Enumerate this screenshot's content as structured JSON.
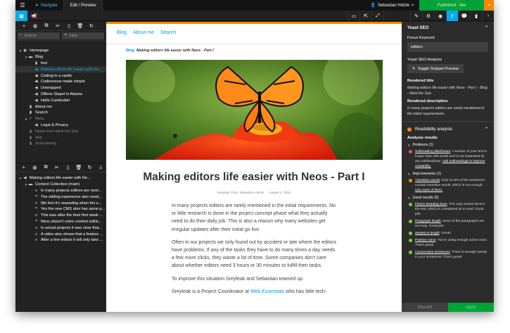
{
  "topbar": {
    "menu_icon": "hamburger-icon",
    "navigate_label": "Navigate",
    "edit_label": "Edit / Preview",
    "user_name": "Sebastian Helzle",
    "published_label": "Published - live",
    "published_color": "#00a338",
    "dropdown_color": "#ff8700"
  },
  "tree": {
    "search_placeholder": "Search",
    "filter_placeholder": "Filter",
    "nodes": [
      {
        "label": "Homepage",
        "depth": 0,
        "icon": "globe-icon",
        "toggle": "▼"
      },
      {
        "label": "Blog",
        "depth": 1,
        "icon": "folder-icon",
        "toggle": "▼"
      },
      {
        "label": "test",
        "depth": 2,
        "icon": "page-icon",
        "toggle": ""
      },
      {
        "label": "Making editors life easier with Ne...",
        "depth": 2,
        "icon": "megaphone-icon",
        "toggle": "",
        "selected": true
      },
      {
        "label": "Coding in a castle",
        "depth": 2,
        "icon": "megaphone-icon",
        "toggle": ""
      },
      {
        "label": "Codereview made simple",
        "depth": 2,
        "icon": "megaphone-icon",
        "toggle": ""
      },
      {
        "label": "Unwrapped",
        "depth": 2,
        "icon": "megaphone-icon",
        "toggle": ""
      },
      {
        "label": "Offene Stapel in Atlanta",
        "depth": 2,
        "icon": "megaphone-icon",
        "toggle": ""
      },
      {
        "label": "Hello Cambodia!",
        "depth": 2,
        "icon": "megaphone-icon",
        "toggle": ""
      },
      {
        "label": "About me",
        "depth": 1,
        "icon": "page-icon",
        "toggle": ""
      },
      {
        "label": "Search",
        "depth": 1,
        "icon": "page-icon",
        "toggle": ""
      },
      {
        "label": "Meta",
        "depth": 1,
        "icon": "share-icon",
        "toggle": "▼",
        "muted": true
      },
      {
        "label": "Legal & Privacy",
        "depth": 2,
        "icon": "megaphone-icon",
        "toggle": ""
      },
      {
        "label": "News from mind the Seb",
        "depth": 1,
        "icon": "page-icon",
        "toggle": "",
        "muted": true
      },
      {
        "label": "404",
        "depth": 1,
        "icon": "page-icon",
        "toggle": "",
        "muted": true
      },
      {
        "label": "Schaubourg",
        "depth": 1,
        "icon": "page-icon",
        "toggle": "",
        "muted": true
      }
    ]
  },
  "content_tree": {
    "nodes": [
      {
        "label": "Making editors life easier with Ne...",
        "depth": 0,
        "icon": "megaphone-icon",
        "toggle": "▼"
      },
      {
        "label": "Content Collection (main)",
        "depth": 1,
        "icon": "folder-icon",
        "toggle": "▼"
      },
      {
        "label": "In many projects editors are rarel...",
        "depth": 2,
        "icon": "text-icon",
        "toggle": ""
      },
      {
        "label": "The editing experience also need...",
        "depth": 2,
        "icon": "quote-icon",
        "toggle": ""
      },
      {
        "label": "We feel it's rewarding when the e...",
        "depth": 2,
        "icon": "text-icon",
        "toggle": ""
      },
      {
        "label": "Yes the new CMS also has some p...",
        "depth": 2,
        "icon": "quote-icon",
        "toggle": ""
      },
      {
        "label": "This was after the their first week ...",
        "depth": 2,
        "icon": "text-icon",
        "toggle": ""
      },
      {
        "label": "Neos doesn't solve content editin...",
        "depth": 2,
        "icon": "quote-icon",
        "toggle": ""
      },
      {
        "label": "In actual projects it was clear that...",
        "depth": 2,
        "icon": "text-icon",
        "toggle": ""
      },
      {
        "label": "A video also shows that a feature ...",
        "depth": 2,
        "icon": "text-icon",
        "toggle": ""
      },
      {
        "label": "After a few videos it will only take ...",
        "depth": 2,
        "icon": "text-icon",
        "toggle": ""
      }
    ]
  },
  "page": {
    "nav": [
      "Blog",
      "About me",
      "Search"
    ],
    "breadcrumb_link": "Blog",
    "breadcrumb_current": "Making editors life easier with Neos - Part I",
    "title": "Making editors life easier with Neos - Part I",
    "author": "Sreyleak Thue, Sebastian Helzle",
    "date": "August 3, 2015",
    "paragraph1": "In many projects editors are rarely mentioned in the initial requirements. No or little research is done in the project concept phase what they actually need to do their daily job. This is also a reason why many websites get irregular updates after their initial go live.",
    "paragraph2": "Often in our projects we only found out by accident or late where the editors have problems. If any of the tasks they have to do many times a day needs a few more clicks, they waste a lot of time. Some companies don't care about whether editors need 3 hours or 30 minutes to fulfill their tasks.",
    "paragraph3": "To improve this situation Sreyleak and Sebastian teamed up.",
    "paragraph4_a": "Sreyleak is a Project Coordinator at ",
    "paragraph4_link": "Web Essentials",
    "paragraph4_b": " who has little tech-"
  },
  "inspector": {
    "section_title": "Yoast SEO",
    "focus_keyword_label": "Focus Keyword",
    "focus_keyword_value": "editors",
    "analysis_label": "Yoast SEO Analysis",
    "toggle_button": "Toggle Snippet Preview",
    "rendered_title_label": "Rendered title",
    "rendered_title_value": "Making editors life easier with Neos - Part I - Blog - Mind the Seb",
    "rendered_desc_label": "Rendered description",
    "rendered_desc_value": "In many projects editors are rarely mentioned in the initial requirements.",
    "readability_label": "Readability analysis",
    "results_label": "Analysis results",
    "problems_label": "Problems (1)",
    "problem1_link": "Subheading distribution",
    "problem1_text": ": 1 section of your text is longer than 300 words and is not separated by any subheadings. ",
    "problem1_link2": "Add subheadings to improve readability.",
    "improvements_label": "Improvements (1)",
    "improve1_link": "Transition words",
    "improve1_text": ": Only 21.6% of the sentences contain transition words, which is not enough. ",
    "improve1_link2": "Use more of them.",
    "good_label": "Good results (5)",
    "good1_link": "Flesch Reading Ease",
    "good1_text": ": The copy scores 66.8 in the test, which is considered ok to read. Good job!",
    "good2_link": "Paragraph length",
    "good2_text": ": None of the paragraphs are too long. Great job!",
    "good3_link": "Sentence length",
    "good3_text": ": Great!",
    "good4_link": "Passive voice",
    "good4_text": ": You're using enough active voice. That's great!",
    "good5_link": "Consecutive sentences",
    "good5_text": ": There is enough variety in your sentences. That's great!",
    "discard_label": "Discard",
    "apply_label": "Apply",
    "colors": {
      "problem": "#ff4d4d",
      "improvement": "#ff8700",
      "good": "#7ad03a"
    }
  }
}
